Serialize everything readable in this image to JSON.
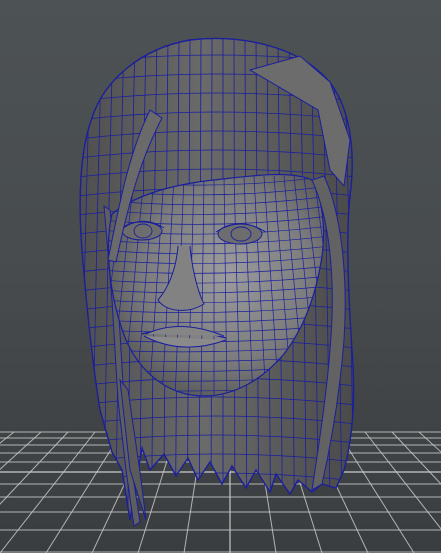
{
  "viewport": {
    "panel": "perspective-viewport",
    "display_mode": "smooth-shade-with-wireframe-on-shaded",
    "background_color": "#474b4d",
    "grid_color": "#c8c8c8",
    "wireframe_color": "#1a1f9c",
    "mesh_shade_color": "#7a7a7a"
  },
  "scene": {
    "object": "head-model-with-hair",
    "grid_visible": true,
    "object_selected": true
  }
}
